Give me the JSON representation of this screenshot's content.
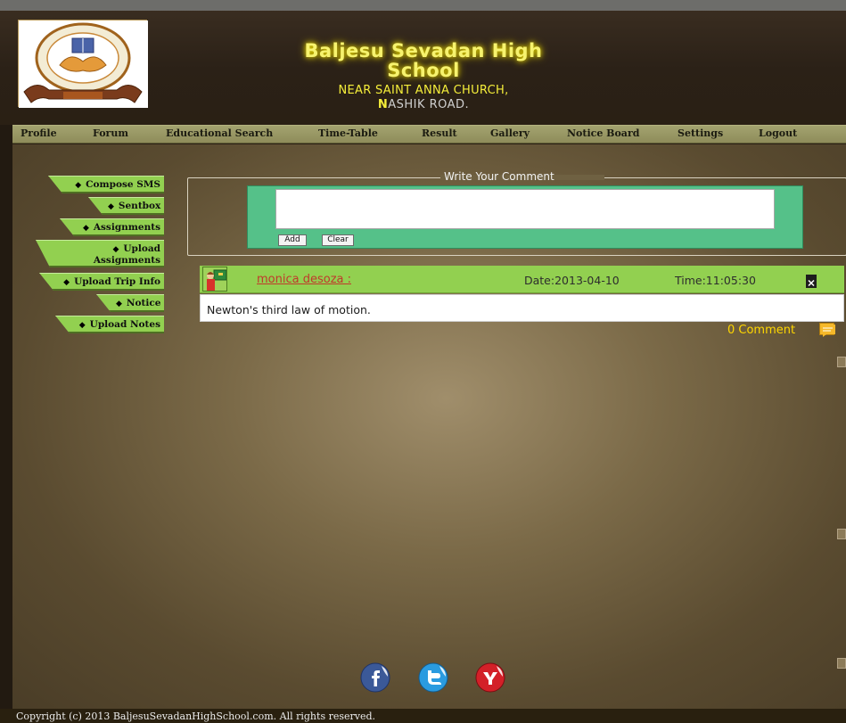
{
  "header": {
    "school_name": "Baljesu Sevadan High School",
    "address_line1": "NEAR SAINT ANNA CHURCH,",
    "address_line2_initial": "N",
    "address_line2_rest": "ASHIK ROAD."
  },
  "nav": {
    "items": [
      "Profile",
      "Forum",
      "Educational Search",
      "Time-Table",
      "Result",
      "Gallery",
      "Notice Board",
      "Settings",
      "Logout"
    ]
  },
  "sidebar": {
    "items": [
      "Compose SMS",
      "Sentbox",
      "Assignments",
      "Upload",
      "Assignments",
      "Upload Trip Info",
      "Notice",
      "Upload Notes"
    ]
  },
  "comment_form": {
    "legend": "Write Your Comment",
    "add_label": "Add",
    "clear_label": "Clear",
    "value": ""
  },
  "post": {
    "author": "monica desoza :",
    "date": "Date:2013-04-10",
    "time": "Time:11:05:30",
    "text": "Newton's third law of motion.",
    "comment_count": "0 Comment"
  },
  "social": {
    "icons": [
      "facebook-icon",
      "twitter-icon",
      "yahoo-icon"
    ]
  },
  "footer": {
    "copyright": "Copyright (c) 2013 BaljesuSevadanHighSchool.com. All rights reserved."
  },
  "colors": {
    "nav_bg": "#9a9a65",
    "sidebar_green": "#92d050",
    "comment_panel": "#55c189",
    "title_glow": "#f7f36e",
    "accent_yellow": "#ffd700",
    "author_red": "#c0392b"
  }
}
